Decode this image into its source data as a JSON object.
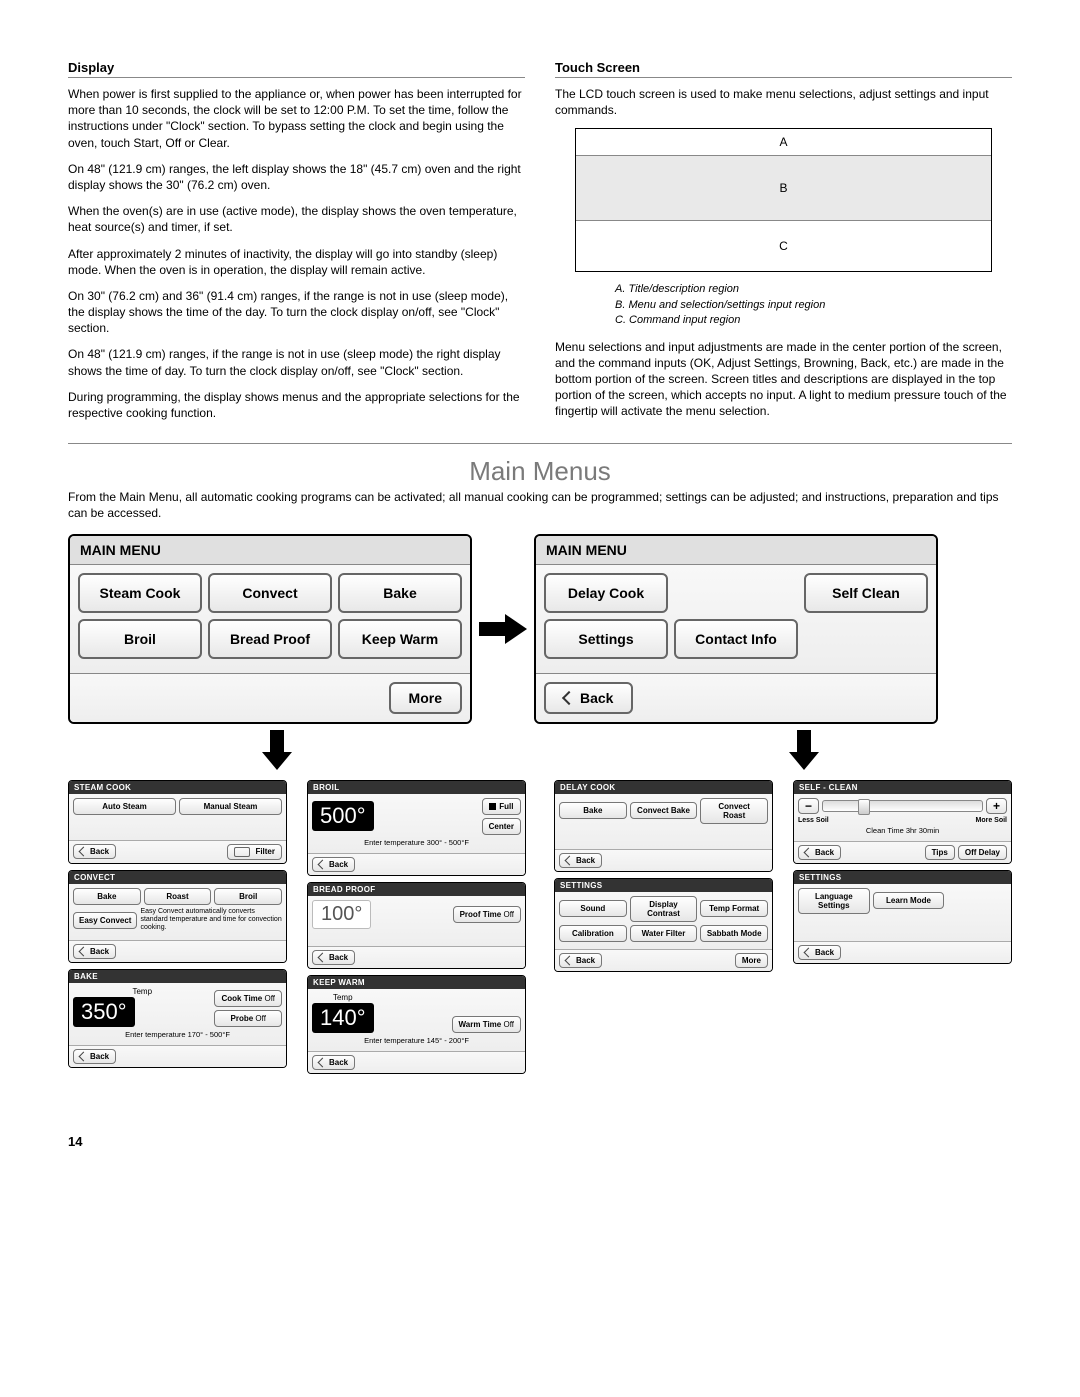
{
  "display": {
    "heading": "Display",
    "p1": "When power is first supplied to the appliance or, when power has been interrupted for more than 10 seconds, the clock will be set to 12:00 P.M. To set the time, follow the instructions under \"Clock\" section. To bypass setting the clock and begin using the oven, touch Start, Off or Clear.",
    "p2": "On 48\" (121.9 cm) ranges, the left display shows the 18\" (45.7 cm) oven and the right display shows the 30\" (76.2 cm) oven.",
    "p3": "When the oven(s) are in use (active mode), the display shows the oven temperature, heat source(s) and timer, if set.",
    "p4": "After approximately 2 minutes of inactivity, the display will go into standby (sleep) mode. When the oven is in operation, the display will remain active.",
    "p5": "On 30\" (76.2 cm) and 36\" (91.4 cm) ranges, if the range is not in use (sleep mode), the display shows the time of the day. To turn the clock display on/off, see \"Clock\" section.",
    "p6": "On 48\" (121.9 cm) ranges, if the range is not in use (sleep mode) the right display shows the time of day. To turn the clock display on/off, see \"Clock\" section.",
    "p7": "During programming, the display shows menus and the appropriate selections for the respective cooking function."
  },
  "touchscreen": {
    "heading": "Touch Screen",
    "p1": "The LCD touch screen is used to make menu selections, adjust settings and input commands.",
    "region_a": "A",
    "region_b": "B",
    "region_c": "C",
    "caption_a": "A. Title/description region",
    "caption_b": "B. Menu and selection/settings input region",
    "caption_c": "C. Command input region",
    "p2": "Menu selections and input adjustments are made in the center portion of the screen, and the command inputs (OK, Adjust Settings, Browning, Back, etc.) are made in the bottom portion of the screen. Screen titles and descriptions are displayed in the top portion of the screen, which accepts no input. A light to medium pressure touch of the fingertip will activate the menu selection."
  },
  "main_menus": {
    "title": "Main Menus",
    "intro": "From the Main Menu, all automatic cooking programs can be activated; all manual cooking can be programmed; settings can be adjusted; and instructions, preparation and tips can be accessed."
  },
  "panel1": {
    "header": "MAIN MENU",
    "btns": [
      "Steam Cook",
      "Convect",
      "Bake",
      "Broil",
      "Bread Proof",
      "Keep Warm"
    ],
    "more": "More"
  },
  "panel2": {
    "header": "MAIN MENU",
    "btns": [
      "Delay Cook",
      "",
      "Self Clean",
      "Settings",
      "Contact Info",
      ""
    ],
    "back": "Back"
  },
  "steam_cook": {
    "header": "STEAM COOK",
    "auto": "Auto Steam",
    "manual": "Manual Steam",
    "back": "Back",
    "filter": "Filter"
  },
  "convect": {
    "header": "CONVECT",
    "bake": "Bake",
    "roast": "Roast",
    "broil": "Broil",
    "easy": "Easy Convect",
    "desc": "Easy Convect automatically converts standard temperature and time for convection cooking.",
    "back": "Back"
  },
  "bake": {
    "header": "BAKE",
    "temp_label": "Temp",
    "temp": "350°",
    "cook_time": "Cook Time",
    "off1": "Off",
    "probe": "Probe",
    "off2": "Off",
    "note": "Enter temperature 170° - 500°F",
    "back": "Back"
  },
  "broil": {
    "header": "BROIL",
    "temp": "500°",
    "full": "Full",
    "center": "Center",
    "note": "Enter temperature 300° - 500°F",
    "back": "Back"
  },
  "bread": {
    "header": "BREAD PROOF",
    "temp": "100°",
    "proof": "Proof Time",
    "off": "Off",
    "back": "Back"
  },
  "keep_warm": {
    "header": "KEEP WARM",
    "temp_label": "Temp",
    "temp": "140°",
    "warm": "Warm Time",
    "off": "Off",
    "note": "Enter temperature 145° - 200°F",
    "back": "Back"
  },
  "delay": {
    "header": "DELAY COOK",
    "bake": "Bake",
    "cbake": "Convect Bake",
    "croast": "Convect Roast",
    "back": "Back"
  },
  "settings1": {
    "header": "SETTINGS",
    "sound": "Sound",
    "disp": "Display Contrast",
    "temp": "Temp Format",
    "cal": "Calibration",
    "water": "Water Filter",
    "sab": "Sabbath Mode",
    "back": "Back",
    "more": "More"
  },
  "self_clean": {
    "header": "SELF - CLEAN",
    "minus": "−",
    "plus": "+",
    "less": "Less Soil",
    "more_soil": "More Soil",
    "clean_time": "Clean Time  3hr  30min",
    "back": "Back",
    "tips": "Tips",
    "delay": "Off Delay"
  },
  "settings2": {
    "header": "SETTINGS",
    "lang": "Language Settings",
    "learn": "Learn Mode",
    "back": "Back"
  },
  "page_number": "14"
}
